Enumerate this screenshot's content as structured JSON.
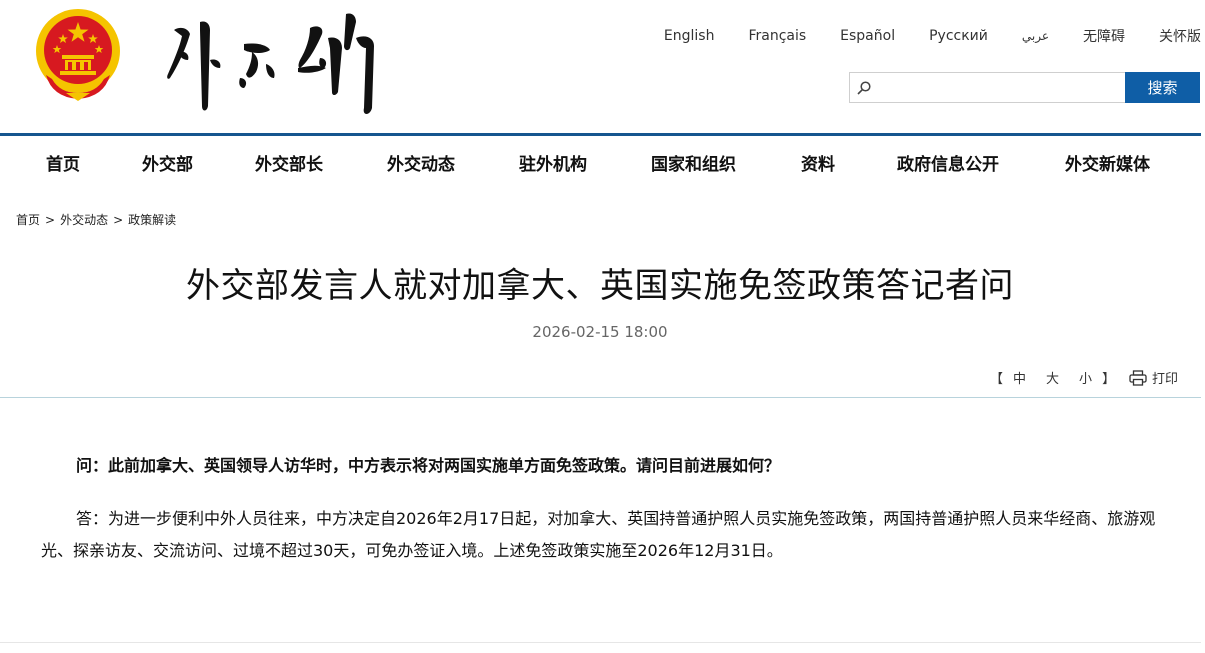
{
  "header": {
    "languages": [
      "English",
      "Français",
      "Español",
      "Русский",
      "عربي",
      "无障碍",
      "关怀版"
    ],
    "search": {
      "placeholder": "",
      "button_label": "搜索"
    }
  },
  "nav": {
    "items": [
      "首页",
      "外交部",
      "外交部长",
      "外交动态",
      "驻外机构",
      "国家和组织",
      "资料",
      "政府信息公开",
      "外交新媒体"
    ]
  },
  "breadcrumb": [
    "首页",
    "外交动态",
    "政策解读"
  ],
  "breadcrumb_separator": ">",
  "article": {
    "title": "外交部发言人就对加拿大、英国实施免签政策答记者问",
    "date": "2026-02-15 18:00",
    "question": "问：此前加拿大、英国领导人访华时，中方表示将对两国实施单方面免签政策。请问目前进展如何？",
    "answer": "答：为进一步便利中外人员往来，中方决定自2026年2月17日起，对加拿大、英国持普通护照人员实施免签政策，两国持普通护照人员来华经商、旅游观光、探亲访友、交流访问、过境不超过30天，可免办签证入境。上述免签政策实施至2026年12月31日。"
  },
  "tools": {
    "bracket_open": "【",
    "font_sizes": [
      "中",
      "大",
      "小"
    ],
    "bracket_close": "】",
    "print_label": "打印"
  },
  "colors": {
    "brand_blue": "#0f5ea6",
    "header_line": "#15568f",
    "emblem_red": "#d71920",
    "emblem_gold": "#f5c400"
  }
}
